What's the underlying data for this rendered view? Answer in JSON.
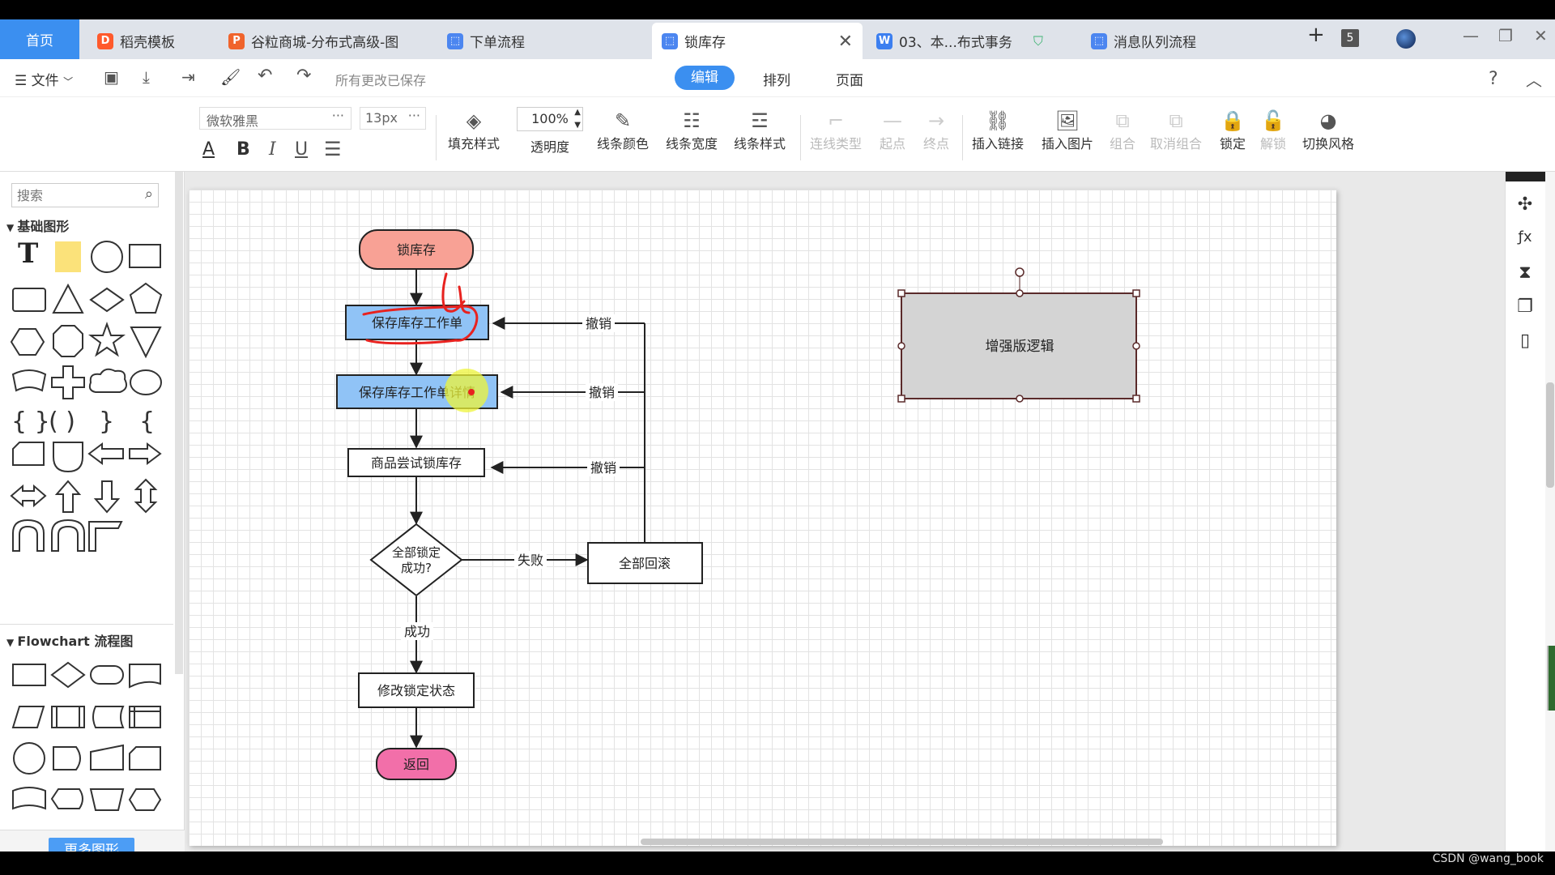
{
  "tabs": {
    "home": "首页",
    "items": [
      {
        "label": "稻壳模板"
      },
      {
        "label": "谷粒商城-分布式高级-图"
      },
      {
        "label": "下单流程"
      },
      {
        "label": "锁库存"
      },
      {
        "label": "03、本...布式事务"
      },
      {
        "label": "消息队列流程"
      }
    ],
    "count_badge": "5"
  },
  "menubar": {
    "file": "文件",
    "saved_status": "所有更改已保存",
    "mode_tabs": [
      "编辑",
      "排列",
      "页面"
    ]
  },
  "toolbar": {
    "font_name": "微软雅黑",
    "font_size": "13px",
    "opacity": "100%",
    "buttons": [
      "填充样式",
      "透明度",
      "线条颜色",
      "线条宽度",
      "线条样式",
      "连线类型",
      "起点",
      "终点",
      "插入链接",
      "插入图片",
      "组合",
      "取消组合",
      "锁定",
      "解锁",
      "切换风格"
    ]
  },
  "left_panel": {
    "search_placeholder": "搜索",
    "section_basic": "基础图形",
    "section_flowchart": "Flowchart 流程图",
    "more_shapes": "更多图形"
  },
  "diagram": {
    "nodes": {
      "start": "锁库存",
      "save_task": "保存库存工作单",
      "save_detail": "保存库存工作单详情",
      "try_lock": "商品尝试锁库存",
      "decision": [
        "全部锁定",
        "成功?"
      ],
      "rollback": "全部回滚",
      "update_state": "修改锁定状态",
      "end": "返回",
      "enhanced": "增强版逻辑"
    },
    "edge_labels": {
      "cancel_1": "撤销",
      "cancel_2": "撤销",
      "cancel_3": "撤销",
      "fail": "失败",
      "success": "成功"
    }
  },
  "credit": "CSDN @wang_book"
}
